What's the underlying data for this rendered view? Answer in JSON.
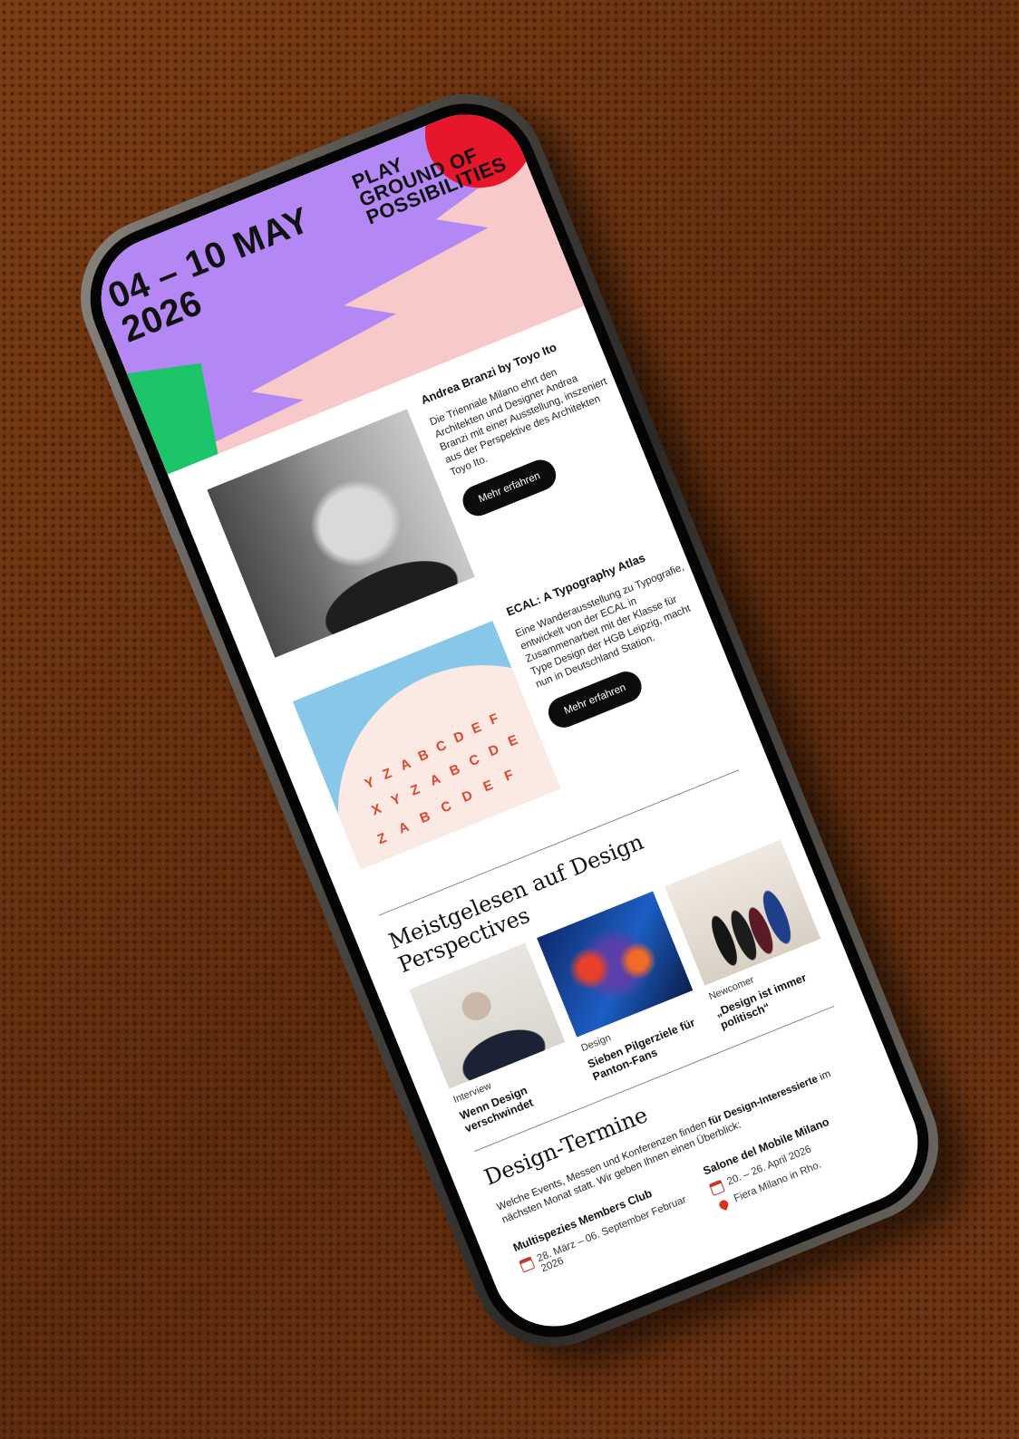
{
  "hero": {
    "date_line1": "04 – 10 MAY",
    "date_line2": "2026",
    "headline": [
      "PLAY",
      "GROUND OF",
      "POSSIBILITIES"
    ],
    "colors": {
      "lavender": "#b388f5",
      "pink": "#f7c9c9",
      "green": "#1cc56a",
      "red": "#e8162a"
    }
  },
  "articles": [
    {
      "title": "Andrea Branzi by Toyo Ito",
      "text": "Die Triennale Milano ehrt den Architekten und Designer Andrea Branzi mit einer Ausstellung, inszeniert aus der Perspektive des Architekten Toyo Ito.",
      "button": "Mehr erfahren"
    },
    {
      "title": "ECAL: A Typography Atlas",
      "text": "Eine Wanderausstellung zu Typografie, entwickelt von der ECAL in Zusammenarbeit mit der Klasse für Type Design der HGB Leipzig, macht nun in Deutschland Station.",
      "button": "Mehr erfahren"
    }
  ],
  "most_read": {
    "heading": "Meistgelesen auf Design Perspectives",
    "items": [
      {
        "category": "Interview",
        "title": "Wenn Design verschwindet"
      },
      {
        "category": "Design",
        "title": "Sieben Pilgerziele für Panton-Fans"
      },
      {
        "category": "Newcomer",
        "title": "„Design ist immer politisch“"
      }
    ]
  },
  "events": {
    "heading": "Design-Termine",
    "intro_start": "Welche Events, Messen und Konferenzen finden ",
    "intro_bold": "für Design-Interessierte",
    "intro_end": " im nächsten Monat statt. Wir geben Ihnen einen Überblick:",
    "items": [
      {
        "name": "Multispezies Members Club",
        "date": "28. März – 06. September Februar 2026"
      },
      {
        "name": "Salone del Mobile Milano",
        "date": "20. – 26. April 2026",
        "location": "Fiera Milano in Rho."
      }
    ]
  }
}
